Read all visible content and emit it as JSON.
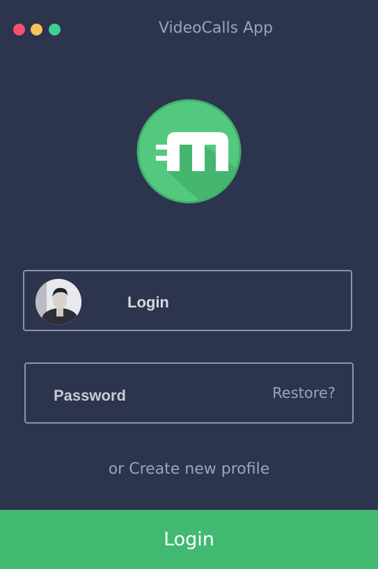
{
  "window": {
    "title": "VideoCalls App",
    "controls": [
      "close-dot",
      "minimize-dot",
      "maximize-dot"
    ],
    "colors": {
      "close": "#f5506e",
      "minimize": "#f7c35b",
      "maximize": "#3fcf94"
    }
  },
  "logo": {
    "icon": "m-logo-icon",
    "color": "#4cc57c"
  },
  "login_field": {
    "label": "Login",
    "avatar": "user-avatar"
  },
  "password_field": {
    "label": "Password",
    "restore_link": "Restore?"
  },
  "create_profile_link": "or Create new profile",
  "login_button": {
    "label": "Login",
    "color": "#42b971"
  },
  "theme": {
    "background": "#2d344d"
  }
}
